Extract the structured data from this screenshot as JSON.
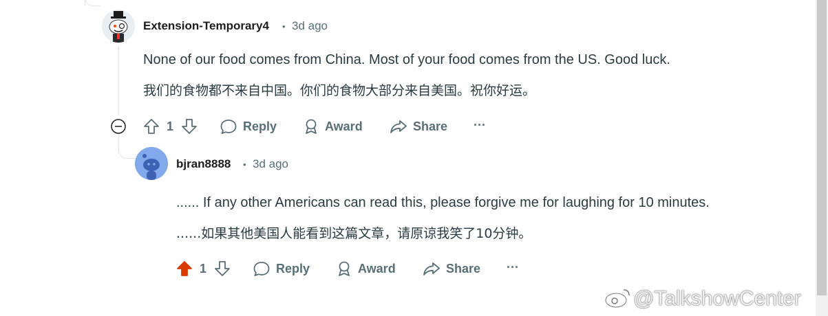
{
  "comment1": {
    "username": "Extension-Temporary4",
    "time": "3d ago",
    "text_en": "None of our food comes from China. Most of your food comes from the US. Good luck.",
    "text_zh": "我们的食物都不来自中国。你们的食物大部分来自美国。祝你好运。",
    "votes": "1",
    "actions": {
      "reply": "Reply",
      "award": "Award",
      "share": "Share",
      "more": "···"
    }
  },
  "comment2": {
    "username": "bjran8888",
    "time": "3d ago",
    "text_en": "...... If any other Americans can read this, please forgive me for laughing for 10 minutes.",
    "text_zh": "......如果其他美国人能看到这篇文章，请原谅我笑了10分钟。",
    "votes": "1",
    "upvoted": true,
    "actions": {
      "reply": "Reply",
      "award": "Award",
      "share": "Share",
      "more": "···"
    }
  },
  "separator": "•",
  "watermark": "@TalkshowCenter",
  "colors": {
    "upvote_active": "#d93a00",
    "meta": "#576f76",
    "text": "#2a3c42"
  }
}
